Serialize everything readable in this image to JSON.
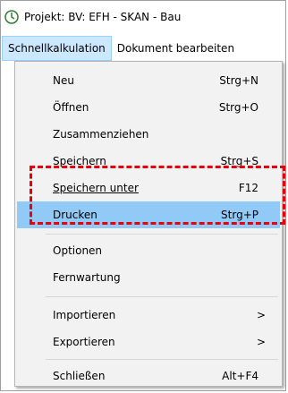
{
  "window": {
    "title": "Projekt: BV: EFH  -  SKAN - Bau",
    "icon": "clock-globe-icon"
  },
  "menubar": {
    "items": [
      {
        "label": "Schnellkalkulation",
        "active": true
      },
      {
        "label": "Dokument bearbeiten",
        "active": false
      }
    ]
  },
  "menu": {
    "items": [
      {
        "label": "Neu",
        "shortcut": "Strg+N"
      },
      {
        "label": "Öffnen",
        "shortcut": "Strg+O"
      },
      {
        "label": "Zusammenziehen",
        "shortcut": ""
      },
      {
        "label": "Speichern",
        "shortcut": "Strg+S"
      },
      {
        "label": "Speichern unter",
        "shortcut": "F12"
      },
      {
        "label": "Drucken",
        "shortcut": "Strg+P",
        "highlighted": true
      },
      {
        "label": "Optionen",
        "shortcut": ""
      },
      {
        "label": "Fernwartung",
        "shortcut": ""
      },
      {
        "label": "Importieren",
        "shortcut": "",
        "submenu": true
      },
      {
        "label": "Exportieren",
        "shortcut": "",
        "submenu": true
      },
      {
        "label": "Schließen",
        "shortcut": "Alt+F4"
      }
    ],
    "submenu_arrow": ">",
    "highlight_color": "#91c9f7",
    "annotation_color": "#e8000b"
  }
}
